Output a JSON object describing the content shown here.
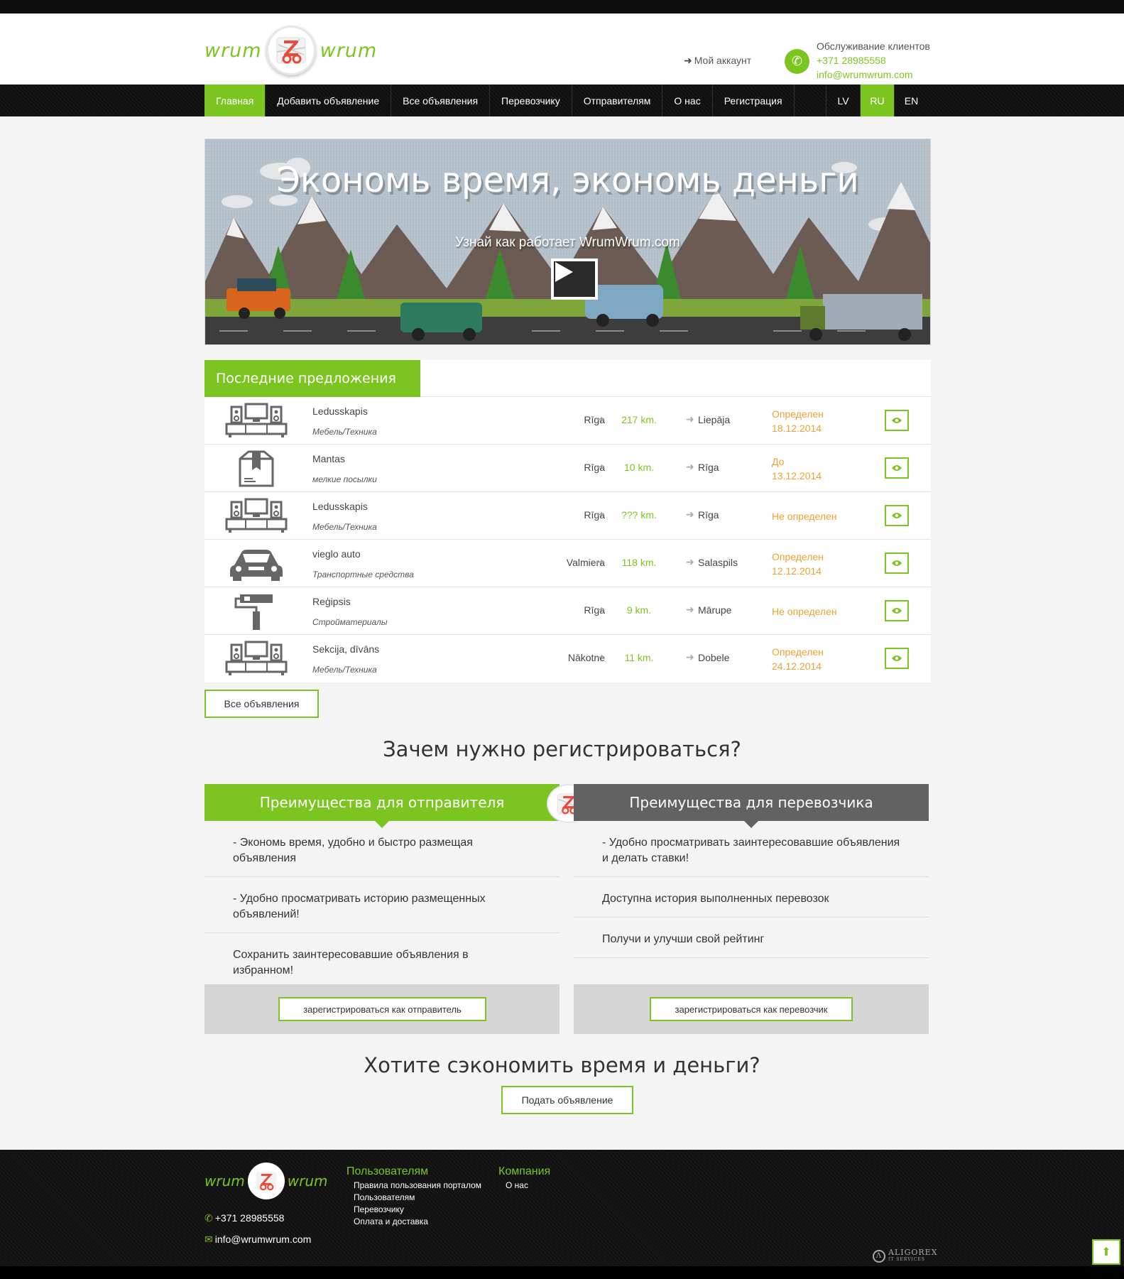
{
  "header": {
    "logo_left": "wrum",
    "logo_right": "wrum",
    "account": "Мой аккаунт",
    "support_label": "Обслуживание клиентов",
    "phone": "+371 28985558",
    "email": "info@wrumwrum.com"
  },
  "nav": {
    "items": [
      {
        "label": "Главная",
        "active": true
      },
      {
        "label": "Добавить объявление"
      },
      {
        "label": "Все объявления"
      },
      {
        "label": "Перевозчику"
      },
      {
        "label": "Отправителям"
      },
      {
        "label": "О нас"
      },
      {
        "label": "Регистрация"
      }
    ],
    "langs": [
      {
        "label": "LV"
      },
      {
        "label": "RU",
        "active": true
      },
      {
        "label": "EN"
      }
    ]
  },
  "hero": {
    "title": "Экономь время, экономь деньги",
    "subtitle": "Узнай как работает WrumWrum.com"
  },
  "offers": {
    "title": "Последние предложения",
    "rows": [
      {
        "icon": "tv-furniture-icon",
        "name": "Ledusskapis",
        "category": "Мебель/Техника",
        "from": "Rīga",
        "distance": "217 km.",
        "to": "Liepāja",
        "date_line1": "Определен",
        "date_line2": "18.12.2014"
      },
      {
        "icon": "parcel-box-icon",
        "name": "Mantas",
        "category": "мелкие посылки",
        "from": "Rīga",
        "distance": "10 km.",
        "to": "Rīga",
        "date_line1": "До",
        "date_line2": "13.12.2014"
      },
      {
        "icon": "tv-furniture-icon",
        "name": "Ledusskapis",
        "category": "Мебель/Техника",
        "from": "Rīga",
        "distance": "??? km.",
        "to": "Rīga",
        "date_line1": "Не определен",
        "date_line2": ""
      },
      {
        "icon": "car-icon",
        "name": "vieglo auto",
        "category": "Транспортные средства",
        "from": "Valmiera",
        "distance": "118 km.",
        "to": "Salaspils",
        "date_line1": "Определен",
        "date_line2": "12.12.2014"
      },
      {
        "icon": "paint-roller-icon",
        "name": "Reģipsis",
        "category": "Стройматериалы",
        "from": "Rīga",
        "distance": "9 km.",
        "to": "Mārupe",
        "date_line1": "Не определен",
        "date_line2": ""
      },
      {
        "icon": "tv-furniture-icon",
        "name": "Sekcija, dīvāns",
        "category": "Мебель/Техника",
        "from": "Nākotne",
        "distance": "11 km.",
        "to": "Dobele",
        "date_line1": "Определен",
        "date_line2": "24.12.2014"
      }
    ],
    "all_button": "Все объявления"
  },
  "why": {
    "title": "Зачем нужно регистрироваться?",
    "sender": {
      "title": "Преимущества для отправителя",
      "points": [
        "- Экономь время, удобно и быстро размещая объявления",
        "- Удобно просматривать историю размещенных объявлений!",
        "Сохранить заинтересовавшие объявления в избранном!"
      ],
      "button": "зарегистрироваться как отправитель"
    },
    "carrier": {
      "title": "Преимущества для перевозчика",
      "points": [
        "- Удобно просматривать заинтересовавшие объявления и делать ставки!",
        "Доступна история выполненных перевозок",
        "Получи и улучши свой рейтинг"
      ],
      "button": "зарегистрироваться как перевозчик"
    }
  },
  "cta": {
    "title": "Хотите сэкономить время и деньги?",
    "button": "Подать объявление"
  },
  "footer": {
    "phone": "+371 28985558",
    "email": "info@wrumwrum.com",
    "users_title": "Пользователям",
    "users_links": [
      "Правила пользования порталом",
      "Пользователям",
      "Перевозчику",
      "Оплата и доставка"
    ],
    "company_title": "Компания",
    "company_links": [
      "О нас"
    ],
    "credit_line1": "ALIGOREX",
    "credit_line2": "IT SERVICES"
  },
  "colors": {
    "accent": "#7cc520",
    "orange": "#f0a030",
    "dark": "#121212",
    "carrier_gray": "#626262"
  }
}
